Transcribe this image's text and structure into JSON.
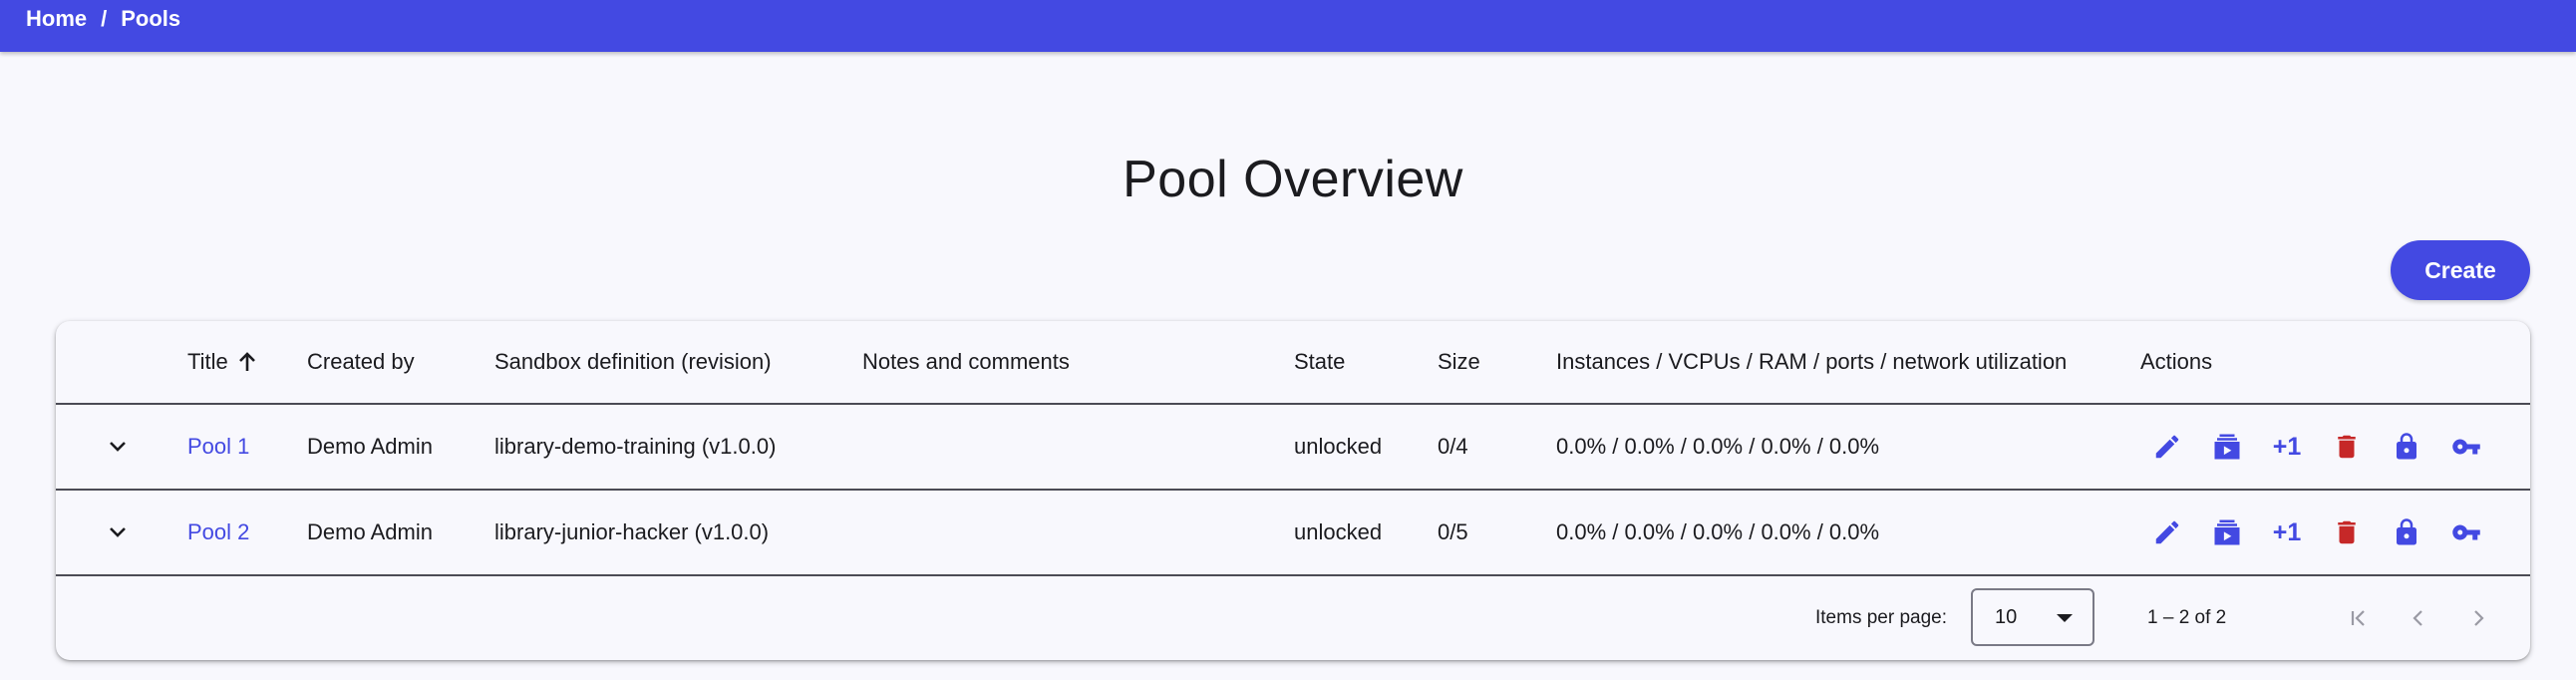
{
  "breadcrumb": {
    "home": "Home",
    "separator": "/",
    "current": "Pools"
  },
  "page": {
    "title": "Pool Overview"
  },
  "toolbar": {
    "create_label": "Create"
  },
  "colors": {
    "accent": "#4349e2",
    "danger": "#c62828",
    "background": "#f8f8fd"
  },
  "table": {
    "columns": {
      "title": "Title",
      "created_by": "Created by",
      "sandbox": "Sandbox definition (revision)",
      "notes": "Notes and comments",
      "state": "State",
      "size": "Size",
      "utilization": "Instances / VCPUs / RAM / ports / network utilization",
      "actions": "Actions"
    },
    "sort": {
      "column": "Title",
      "direction": "ascending",
      "icon": "arrow-up-icon"
    },
    "rows": [
      {
        "title": "Pool 1",
        "created_by": "Demo Admin",
        "sandbox": "library-demo-training (v1.0.0)",
        "notes": "",
        "state": "unlocked",
        "size": "0/4",
        "utilization": "0.0% / 0.0% / 0.0% / 0.0% / 0.0%"
      },
      {
        "title": "Pool 2",
        "created_by": "Demo Admin",
        "sandbox": "library-junior-hacker (v1.0.0)",
        "notes": "",
        "state": "unlocked",
        "size": "0/5",
        "utilization": "0.0% / 0.0% / 0.0% / 0.0% / 0.0%"
      }
    ],
    "row_actions": {
      "icons": [
        "edit-icon",
        "allocate-icon",
        "plus-one",
        "delete-icon",
        "lock-icon",
        "key-icon"
      ],
      "plus_one_label": "+1"
    }
  },
  "paginator": {
    "items_per_page_label": "Items per page:",
    "items_per_page_value": "10",
    "range_label": "1 – 2 of 2"
  }
}
